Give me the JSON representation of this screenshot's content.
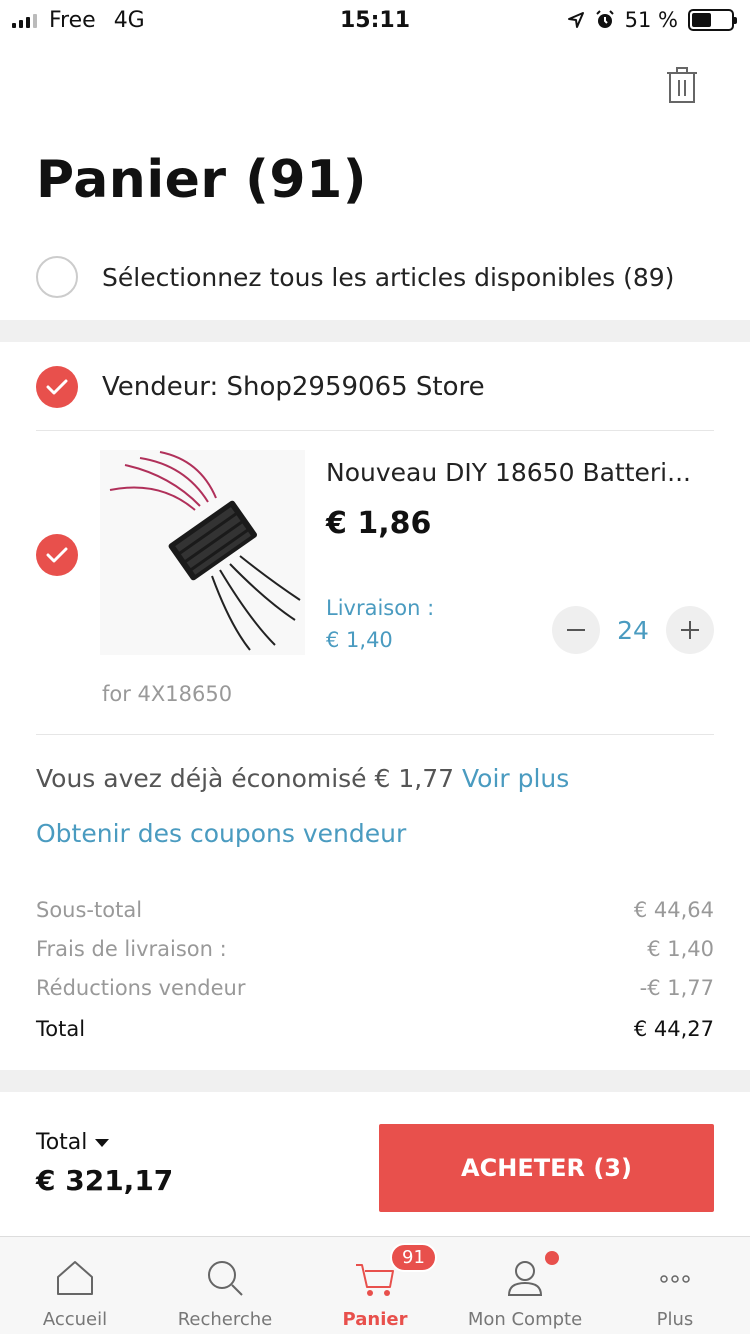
{
  "status_bar": {
    "carrier": "Free",
    "network": "4G",
    "time": "15:11",
    "battery": "51 %",
    "battery_level": 0.51
  },
  "header": {
    "title": "Panier (91)"
  },
  "select_all": {
    "label": "Sélectionnez tous les articles disponibles (89)"
  },
  "seller": {
    "label": "Vendeur: Shop2959065 Store"
  },
  "item": {
    "title": "Nouveau DIY 18650 Batteri...",
    "price": "€ 1,86",
    "shipping_label": "Livraison :",
    "shipping_value": "€ 1,40",
    "quantity": "24",
    "variant": "for 4X18650"
  },
  "savings": {
    "text": "Vous avez déjà économisé € 1,77",
    "link": "Voir plus"
  },
  "coupons": {
    "label": "Obtenir des coupons vendeur"
  },
  "summary": {
    "subtotal_label": "Sous-total",
    "subtotal_value": "€ 44,64",
    "shipping_label": "Frais de livraison :",
    "shipping_value": "€ 1,40",
    "discount_label": "Réductions vendeur",
    "discount_value": "-€ 1,77",
    "total_label": "Total",
    "total_value": "€ 44,27"
  },
  "footer": {
    "total_label": "Total",
    "total_value": "€ 321,17",
    "buy_label": "ACHETER (3)"
  },
  "tabs": [
    {
      "label": "Accueil",
      "icon": "home-icon"
    },
    {
      "label": "Recherche",
      "icon": "search-icon"
    },
    {
      "label": "Panier",
      "icon": "cart-icon",
      "badge": "91"
    },
    {
      "label": "Mon Compte",
      "icon": "user-icon"
    },
    {
      "label": "Plus",
      "icon": "more-icon"
    }
  ],
  "colors": {
    "accent": "#e8504c",
    "link": "#4a9bc0",
    "muted": "#999999"
  }
}
